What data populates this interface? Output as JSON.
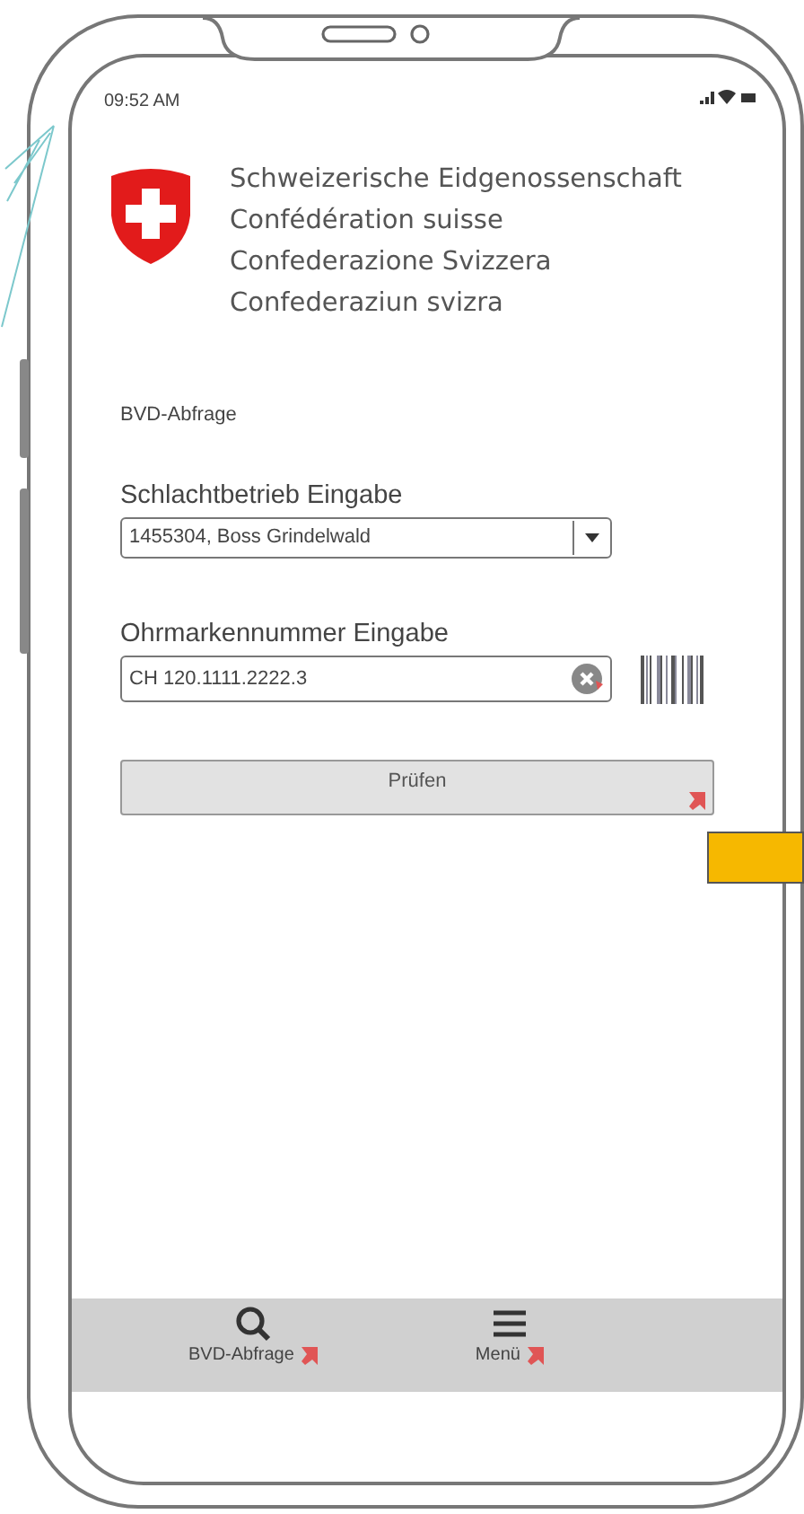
{
  "status_bar": {
    "time": "09:52 AM"
  },
  "header": {
    "lines": [
      "Schweizerische Eidgenossenschaft",
      "Confédération suisse",
      "Confederazione Svizzera",
      "Confederaziun svizra"
    ]
  },
  "page_title": "BVD-Abfrage",
  "fields": [
    {
      "kind": "select",
      "label": "Schlachtbetrieb Eingabe",
      "value": "1455304, Boss Grindelwald"
    },
    {
      "kind": "text",
      "label": "Ohrmarkennummer Eingabe",
      "value": "CH 120.1111.2222.3"
    }
  ],
  "button": {
    "label": "Prüfen",
    "linked": true
  },
  "nav": [
    {
      "kind": "search",
      "label": "BVD-Abfrage",
      "linked": true
    },
    {
      "kind": "menu",
      "label": "Menü",
      "linked": true
    }
  ]
}
